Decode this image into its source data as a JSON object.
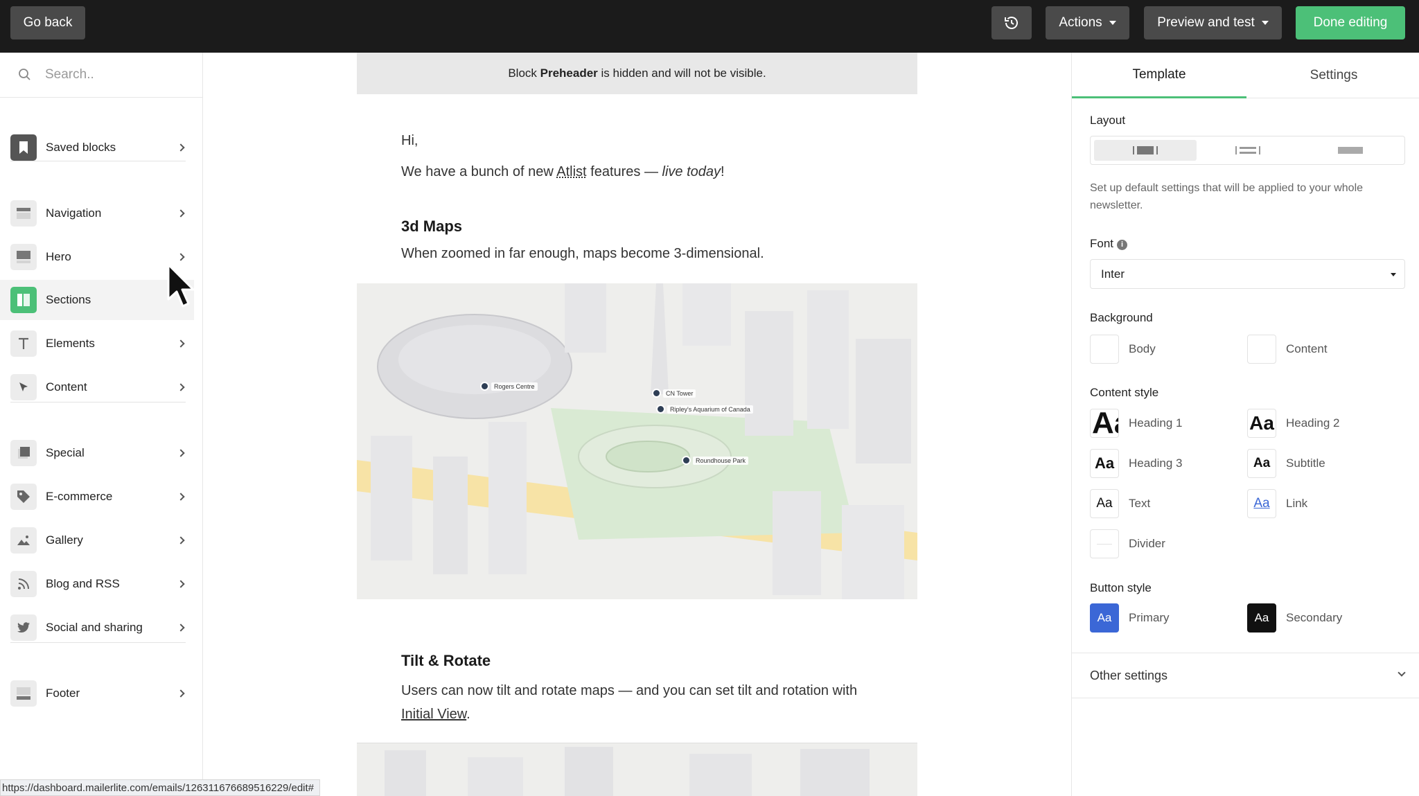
{
  "topbar": {
    "go_back": "Go back",
    "history_icon": "history-icon",
    "actions": "Actions",
    "preview": "Preview and test",
    "done": "Done editing"
  },
  "sidebar": {
    "search_placeholder": "Search..",
    "items": [
      {
        "label": "Saved blocks",
        "icon": "bookmark-icon"
      },
      {
        "label": "Navigation",
        "icon": "navigation-icon"
      },
      {
        "label": "Hero",
        "icon": "hero-icon"
      },
      {
        "label": "Sections",
        "icon": "sections-icon"
      },
      {
        "label": "Elements",
        "icon": "text-icon"
      },
      {
        "label": "Content",
        "icon": "pointer-icon"
      },
      {
        "label": "Special",
        "icon": "special-icon"
      },
      {
        "label": "E-commerce",
        "icon": "tag-icon"
      },
      {
        "label": "Gallery",
        "icon": "image-icon"
      },
      {
        "label": "Blog and RSS",
        "icon": "rss-icon"
      },
      {
        "label": "Social and sharing",
        "icon": "twitter-icon"
      },
      {
        "label": "Footer",
        "icon": "footer-icon"
      }
    ]
  },
  "status_url": "https://dashboard.mailerlite.com/emails/126311676689516229/edit#",
  "email": {
    "preheader_pre": "Block ",
    "preheader_bold": "Preheader",
    "preheader_post": " is hidden and will not be visible.",
    "greeting": "Hi,",
    "intro_pre": "We have a bunch of new ",
    "intro_brand": "Atlist",
    "intro_mid": " features — ",
    "intro_italic": "live today",
    "intro_end": "!",
    "section1_title": "3d Maps",
    "section1_text": "When zoomed in far enough, maps become 3-dimensional.",
    "map_labels": [
      "Rogers Centre",
      "CN Tower",
      "Ripley's Aquarium of Canada",
      "Roundhouse Park"
    ],
    "section2_title": "Tilt & Rotate",
    "section2_text_pre": "Users can now tilt and rotate maps — and you can set tilt and rotation with ",
    "section2_link": "Initial View",
    "section2_text_end": "."
  },
  "panel": {
    "tabs": [
      "Template",
      "Settings"
    ],
    "layout_label": "Layout",
    "description": "Set up default settings that will be applied to your whole newsletter.",
    "font_label": "Font",
    "font_value": "Inter",
    "background_label": "Background",
    "bg_body": "Body",
    "bg_content": "Content",
    "content_style_label": "Content style",
    "styles": [
      "Heading 1",
      "Heading 2",
      "Heading 3",
      "Subtitle",
      "Text",
      "Link",
      "Divider"
    ],
    "swatch_text": "Aa",
    "button_style_label": "Button style",
    "button_primary": "Primary",
    "button_secondary": "Secondary",
    "other_settings": "Other settings"
  },
  "colors": {
    "accent_green": "#4cc078",
    "topbar": "#1b1b1b",
    "primary_button": "#3b67d6",
    "link": "#3b67d6"
  }
}
